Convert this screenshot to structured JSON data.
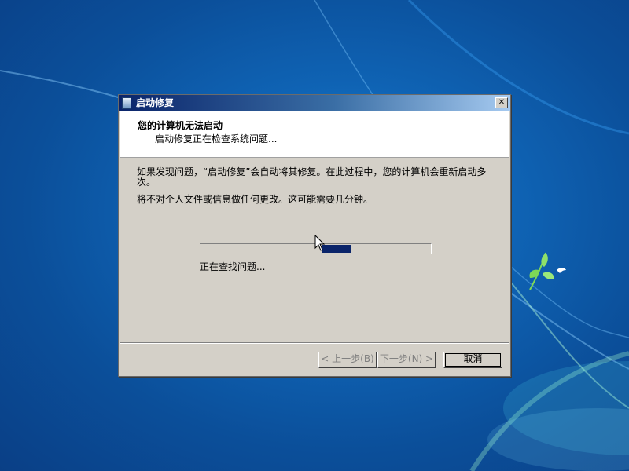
{
  "dialog": {
    "title": "启动修复",
    "close_label": "✕"
  },
  "header": {
    "title": "您的计算机无法启动",
    "subtitle": "启动修复正在检查系统问题..."
  },
  "body": {
    "paragraph1": "如果发现问题，“启动修复”会自动将其修复。在此过程中，您的计算机会重新启动多次。",
    "paragraph2": "将不对个人文件或信息做任何更改。这可能需要几分钟。"
  },
  "progress": {
    "status_label": "正在查找问题...",
    "indeterminate": true,
    "fill_color": "#0a246a"
  },
  "buttons": {
    "back_label": "< 上一步(B)",
    "next_label": "下一步(N) >",
    "cancel_label": "取消"
  },
  "colors": {
    "desktop": "#0f63b4",
    "dialog_face": "#d4d0c8",
    "title_bar": "#0a246a"
  },
  "icons": {
    "app": "startup-repair-icon",
    "close": "close-icon",
    "cursor": "mouse-pointer-icon"
  }
}
